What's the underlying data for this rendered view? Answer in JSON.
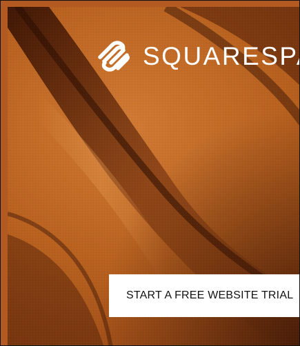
{
  "ad": {
    "brand": "SQUARESPA",
    "cta_label": "START A FREE WEBSITE TRIAL",
    "logo_icon": "squarespace-logo-icon"
  },
  "colors": {
    "fabric_base": "#b8611f",
    "fabric_shadow": "#5a2208",
    "fabric_highlight": "#e08c44",
    "cta_background": "#ffffff",
    "text_light": "#ffffff",
    "text_dark": "#111111"
  }
}
